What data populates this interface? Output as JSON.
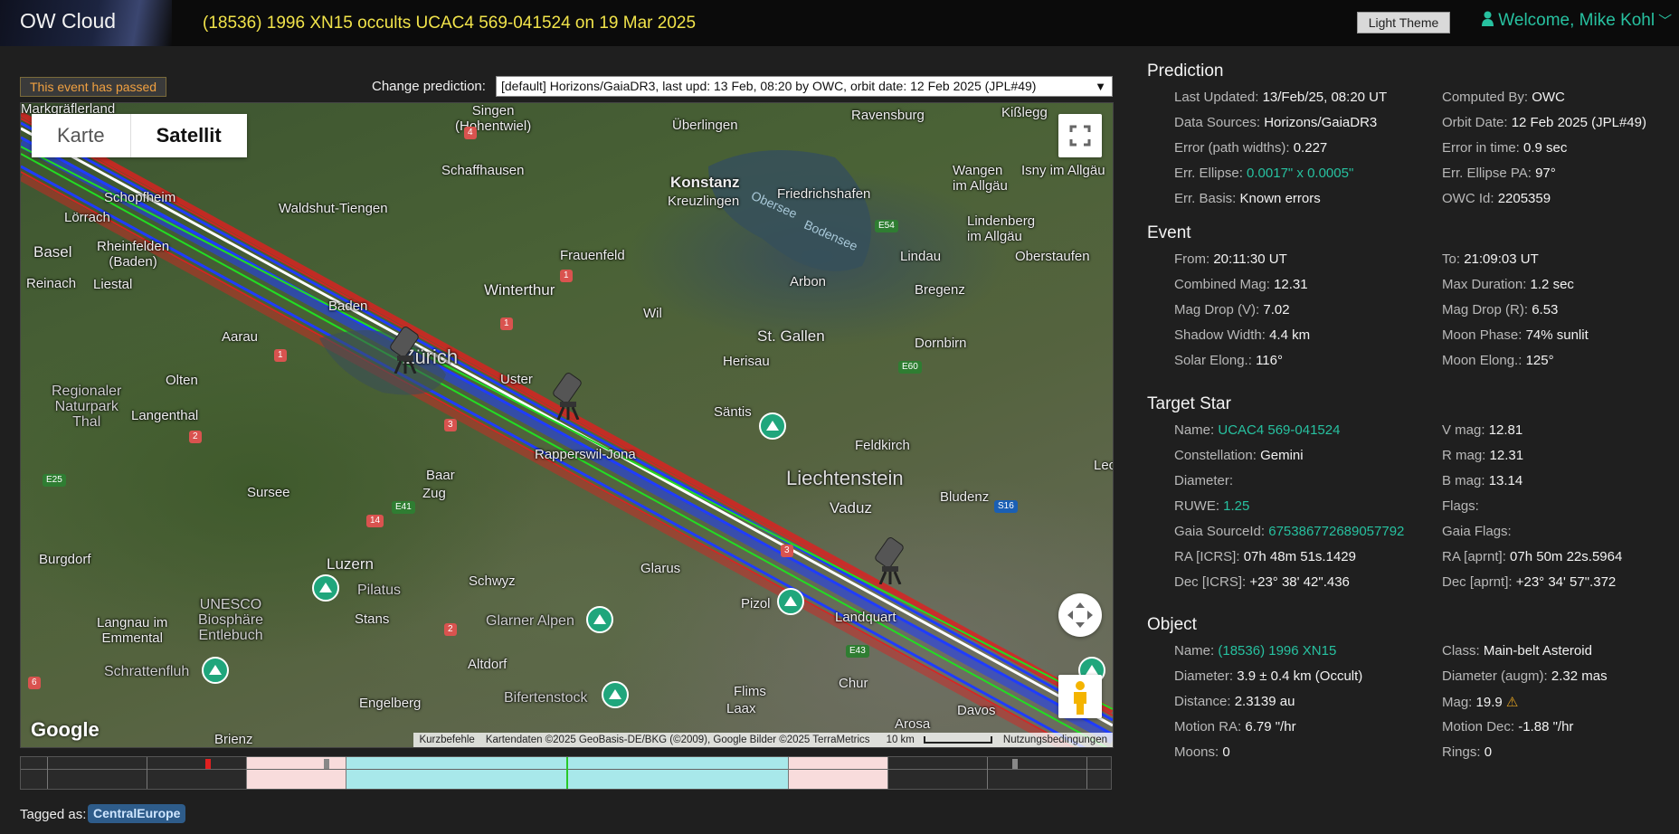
{
  "header": {
    "brand": "OW Cloud",
    "event_title": "(18536) 1996 XN15 occults UCAC4 569-041524 on 19 Mar 2025",
    "theme_button": "Light Theme",
    "welcome": "Welcome, Mike Kohl"
  },
  "left": {
    "passed_badge": "This event has passed",
    "change_label": "Change prediction:",
    "prediction_select": "[default] Horizons/GaiaDR3, last upd: 13 Feb, 08:20 by OWC, orbit date: 12 Feb 2025 (JPL#49)",
    "tagged_label": "Tagged as:",
    "tag": "CentralEurope"
  },
  "map": {
    "toggle_map": "Karte",
    "toggle_satellite": "Satellit",
    "attribution_shortcuts": "Kurzbefehle",
    "attribution_data": "Kartendaten ©2025 GeoBasis-DE/BKG (©2009), Google Bilder ©2025 TerraMetrics",
    "attribution_scale": "10 km",
    "attribution_terms": "Nutzungsbedingungen",
    "google": "Google",
    "labels": {
      "markgraeflerland": "Markgräflerland",
      "hohentwiel": "Singen\n(Hohentwiel)",
      "ueberlingen": "Überlingen",
      "ravensburg": "Ravensburg",
      "kisslegg": "Kißlegg",
      "schaffhausen": "Schaffhausen",
      "konstanz": "Konstanz",
      "kreuzlingen": "Kreuzlingen",
      "wangen": "Wangen\nim Allgäu",
      "isny": "Isny im Allgäu",
      "schopfheim": "Schopfheim",
      "waldshut": "Waldshut-Tiengen",
      "friedrichshafen": "Friedrichshafen",
      "lorrach": "Lörrach",
      "obersee": "Obersee",
      "bodensee": "Bodensee",
      "lindenberg": "Lindenberg\nim Allgäu",
      "rheinfelden": "Rheinfelden\n(Baden)",
      "basel": "Basel",
      "frauenfeld": "Frauenfeld",
      "lindau": "Lindau",
      "oberstaufen": "Oberstaufen",
      "reinach": "Reinach",
      "liestal": "Liestal",
      "winterthur": "Winterthur",
      "arbon": "Arbon",
      "bregenz": "Bregenz",
      "baden": "Baden",
      "wil": "Wil",
      "aarau": "Aarau",
      "zurich": "Zürich",
      "stgallen": "St. Gallen",
      "dornbirn": "Dornbirn",
      "herisau": "Herisau",
      "olten": "Olten",
      "uster": "Uster",
      "naturpark": "Regionaler\nNaturpark\nThal",
      "langenthal": "Langenthal",
      "santis": "Säntis",
      "feldkirch": "Feldkirch",
      "rapperswil": "Rapperswil-Jona",
      "liechtenstein": "Liechtenstein",
      "baar": "Baar",
      "zug": "Zug",
      "vaduz": "Vaduz",
      "bludenz": "Bludenz",
      "sursee": "Sursee",
      "burgdorf": "Burgdorf",
      "luzern": "Luzern",
      "schwyz": "Schwyz",
      "glarus": "Glarus",
      "pilatus": "Pilatus",
      "unesco": "UNESCO\nBiosphäre\nEntlebuch",
      "stans": "Stans",
      "glarneralpen": "Glarner Alpen",
      "pizol": "Pizol",
      "landquart": "Landquart",
      "langnau": "Langnau im\nEmmental",
      "schrattenfluh": "Schrattenfluh",
      "altdorf": "Altdorf",
      "chur": "Chur",
      "engelberg": "Engelberg",
      "biferten": "Bifertenstock",
      "flims": "Flims",
      "laax": "Laax",
      "davos": "Davos",
      "arosa": "Arosa",
      "brienz": "Brienz",
      "lec": "Lec"
    },
    "roads": {
      "r4": "4",
      "e54": "E54",
      "r1a": "1",
      "r1b": "1",
      "r1c": "1",
      "r2a": "2",
      "r3a": "3",
      "e60": "E60",
      "e25": "E25",
      "e41": "E41",
      "r14": "14",
      "r3b": "3",
      "s16": "S16",
      "r2b": "2",
      "e43": "E43",
      "r6": "6"
    },
    "colors": {
      "path_center": "#ffffff",
      "path_edge": "#1f3cff",
      "path_error": "#e02020",
      "path_sigma": "#22dd22"
    }
  },
  "prediction": {
    "title": "Prediction",
    "rows": [
      [
        {
          "k": "Last Updated:",
          "v": "13/Feb/25, 08:20 UT"
        },
        {
          "k": "Computed By:",
          "v": "OWC"
        }
      ],
      [
        {
          "k": "Data Sources:",
          "v": "Horizons/GaiaDR3"
        },
        {
          "k": "Orbit Date:",
          "v": "12 Feb 2025 (JPL#49)"
        }
      ],
      [
        {
          "k": "Error (path widths):",
          "v": "0.227"
        },
        {
          "k": "Error in time:",
          "v": "0.9 sec"
        }
      ],
      [
        {
          "k": "Err. Ellipse:",
          "v": "0.0017\" x 0.0005\""
        },
        {
          "k": "Err. Ellipse PA:",
          "v": "97°"
        }
      ],
      [
        {
          "k": "Err. Basis:",
          "v": "Known errors"
        },
        {
          "k": "OWC Id:",
          "v": "2205359"
        }
      ]
    ]
  },
  "event": {
    "title": "Event",
    "rows": [
      [
        {
          "k": "From:",
          "v": "20:11:30 UT"
        },
        {
          "k": "To:",
          "v": "21:09:03 UT"
        }
      ],
      [
        {
          "k": "Combined Mag:",
          "v": "12.31"
        },
        {
          "k": "Max Duration:",
          "v": "1.2 sec"
        }
      ],
      [
        {
          "k": "Mag Drop (V):",
          "v": "7.02"
        },
        {
          "k": "Mag Drop (R):",
          "v": "6.53"
        }
      ],
      [
        {
          "k": "Shadow Width:",
          "v": "4.4 km"
        },
        {
          "k": "Moon Phase:",
          "v": "74% sunlit"
        }
      ],
      [
        {
          "k": "Solar Elong.:",
          "v": "116°"
        },
        {
          "k": "Moon Elong.:",
          "v": "125°"
        }
      ]
    ]
  },
  "target": {
    "title": "Target Star",
    "rows": [
      [
        {
          "k": "Name:",
          "v": "UCAC4 569-041524"
        },
        {
          "k": "V mag:",
          "v": "12.81"
        }
      ],
      [
        {
          "k": "Constellation:",
          "v": "Gemini"
        },
        {
          "k": "R mag:",
          "v": "12.31"
        }
      ],
      [
        {
          "k": "Diameter:",
          "v": ""
        },
        {
          "k": "B mag:",
          "v": "13.14"
        }
      ],
      [
        {
          "k": "RUWE:",
          "v": "1.25"
        },
        {
          "k": "Flags:",
          "v": ""
        }
      ],
      [
        {
          "k": "Gaia SourceId:",
          "v": "675386772689057792"
        },
        {
          "k": "Gaia Flags:",
          "v": ""
        }
      ],
      [
        {
          "k": "RA [ICRS]:",
          "v": "07h 48m 51s.1429"
        },
        {
          "k": "RA [aprnt]:",
          "v": "07h 50m 22s.5964"
        }
      ],
      [
        {
          "k": "Dec [ICRS]:",
          "v": "+23° 38' 42\".436"
        },
        {
          "k": "Dec [aprnt]:",
          "v": "+23° 34' 57\".372"
        }
      ]
    ]
  },
  "object": {
    "title": "Object",
    "rows": [
      [
        {
          "k": "Name:",
          "v": "(18536) 1996 XN15"
        },
        {
          "k": "Class:",
          "v": "Main-belt Asteroid"
        }
      ],
      [
        {
          "k": "Diameter:",
          "v": "3.9 ± 0.4 km  (Occult)"
        },
        {
          "k": "Diameter (augm):",
          "v": "2.32 mas"
        }
      ],
      [
        {
          "k": "Distance:",
          "v": "2.3139 au"
        },
        {
          "k": "Mag:",
          "v": "19.9"
        }
      ],
      [
        {
          "k": "Motion RA:",
          "v": "6.79 \"/hr"
        },
        {
          "k": "Motion Dec:",
          "v": "-1.88 \"/hr"
        }
      ],
      [
        {
          "k": "Moons:",
          "v": "0"
        },
        {
          "k": "Rings:",
          "v": "0"
        }
      ]
    ]
  }
}
